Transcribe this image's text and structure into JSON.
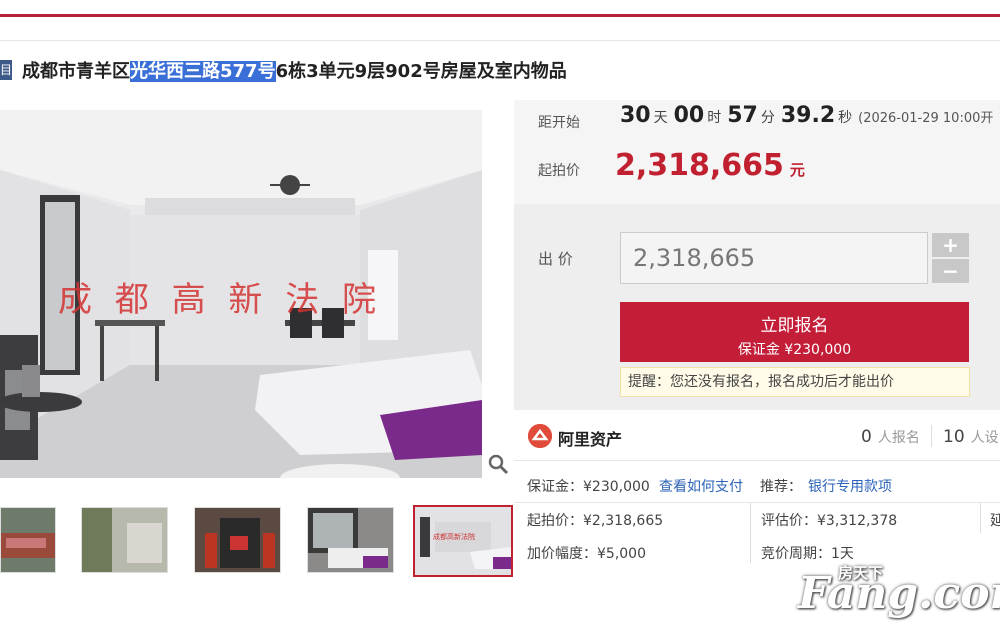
{
  "title": {
    "tag": "目",
    "prefix": "成都市青羊区",
    "highlight": "光华西三路577号",
    "suffix": "6栋3单元9层902号房屋及室内物品"
  },
  "image": {
    "watermark_text": "成 都 高 新 法 院"
  },
  "countdown": {
    "label": "距开始",
    "days": "30",
    "days_unit": "天",
    "hours": "00",
    "hours_unit": "时",
    "minutes": "57",
    "minutes_unit": "分",
    "seconds": "39.2",
    "seconds_unit": "秒",
    "start_time": "(2026-01-29 10:00开"
  },
  "start_price": {
    "label": "起拍价",
    "value": "2,318,665",
    "unit": "元"
  },
  "bid": {
    "label": "出 价",
    "input_value": "2,318,665",
    "plus": "+",
    "minus": "−",
    "signup_label": "立即报名",
    "deposit_label": "保证金 ¥230,000",
    "notice": "提醒：您还没有报名，报名成功后才能出价"
  },
  "org": {
    "name": "阿里资产",
    "signups_count": "0",
    "signups_label": "人报名",
    "reminders_count": "10",
    "reminders_label": "人设"
  },
  "details": {
    "deposit": "保证金：¥230,000",
    "how_to_pay": "查看如何支付",
    "recommend_label": "推荐：",
    "recommend_link": "银行专用款项",
    "start_price": "起拍价：¥2,318,665",
    "appraisal": "评估价：¥3,312,378",
    "increment": "加价幅度：¥5,000",
    "cycle": "竞价周期：1天",
    "edge_char": "延"
  },
  "site_watermark": {
    "small": "房天下",
    "main": "Fang.com"
  },
  "colors": {
    "accent": "#c0202f",
    "link": "#2c63b8",
    "highlight": "#3b6fd8"
  }
}
